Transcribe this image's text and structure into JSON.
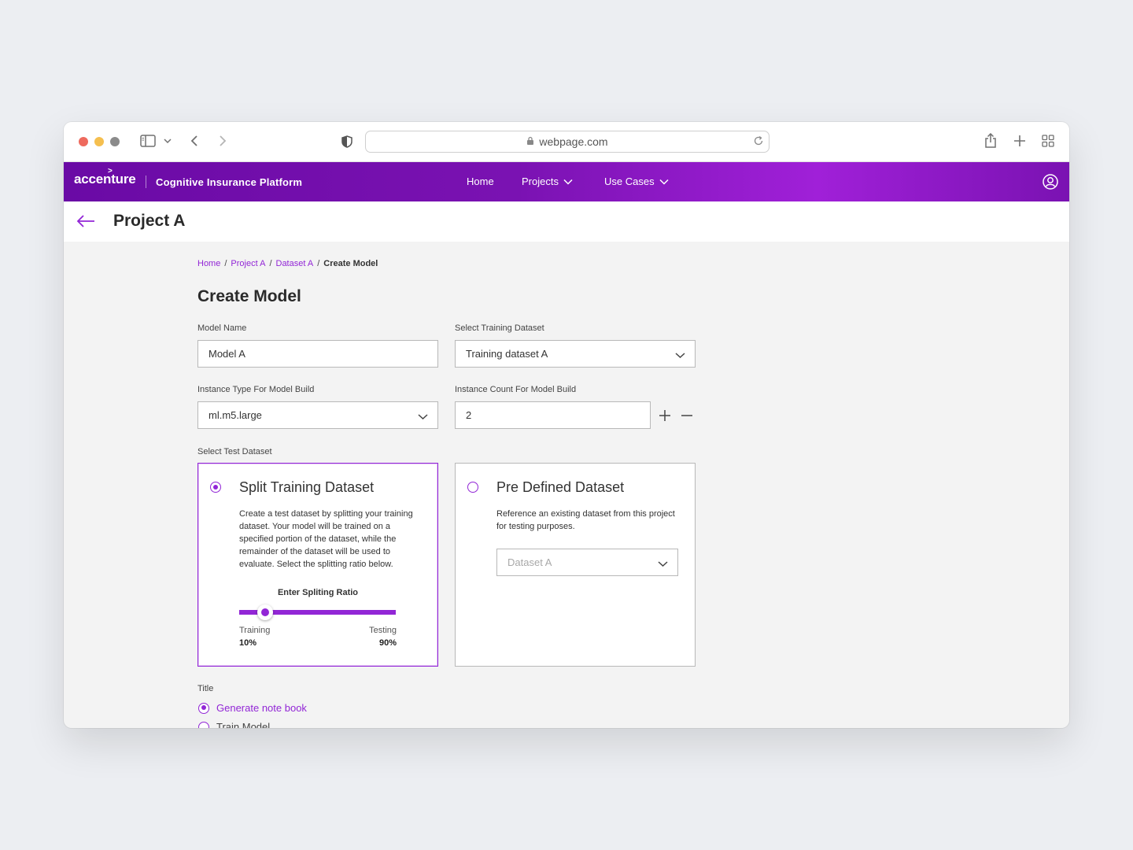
{
  "browser": {
    "url": "webpage.com"
  },
  "appbar": {
    "brand": "accenture",
    "brand_mark": ">",
    "platform": "Cognitive Insurance Platform",
    "nav": [
      "Home",
      "Projects",
      "Use Cases"
    ]
  },
  "page": {
    "title": "Project A"
  },
  "breadcrumb": {
    "items": [
      "Home",
      "Project A",
      "Dataset A"
    ],
    "current": "Create Model",
    "separator": "/"
  },
  "form": {
    "heading": "Create Model",
    "model_name": {
      "label": "Model Name",
      "value": "Model A"
    },
    "training_dataset": {
      "label": "Select Training Dataset",
      "value": "Training dataset A"
    },
    "instance_type": {
      "label": "Instance Type For Model Build",
      "value": "ml.m5.large"
    },
    "instance_count": {
      "label": "Instance Count For Model Build",
      "value": "2"
    },
    "test_dataset_label": "Select Test Dataset",
    "split_card": {
      "title": "Split Training Dataset",
      "description": "Create a test dataset by splitting your training dataset. Your model will be trained on a specified portion of the dataset, while the remainder of the dataset will be used to evaluate. Select the splitting ratio below.",
      "ratio_title": "Enter Spliting Ratio",
      "training_label": "Training",
      "training_value": "10%",
      "testing_label": "Testing",
      "testing_value": "90%",
      "selected": true
    },
    "predefined_card": {
      "title": "Pre Defined Dataset",
      "description": "Reference an existing dataset from this project for testing purposes.",
      "placeholder": "Dataset A",
      "selected": false
    },
    "title_group": {
      "label": "Title",
      "options": [
        {
          "label": "Generate note book",
          "selected": true
        },
        {
          "label": "Train Model",
          "selected": false
        }
      ]
    }
  },
  "colors": {
    "accent": "#9226d6",
    "header_start": "#6a0aa5",
    "header_mid": "#a020d8"
  }
}
